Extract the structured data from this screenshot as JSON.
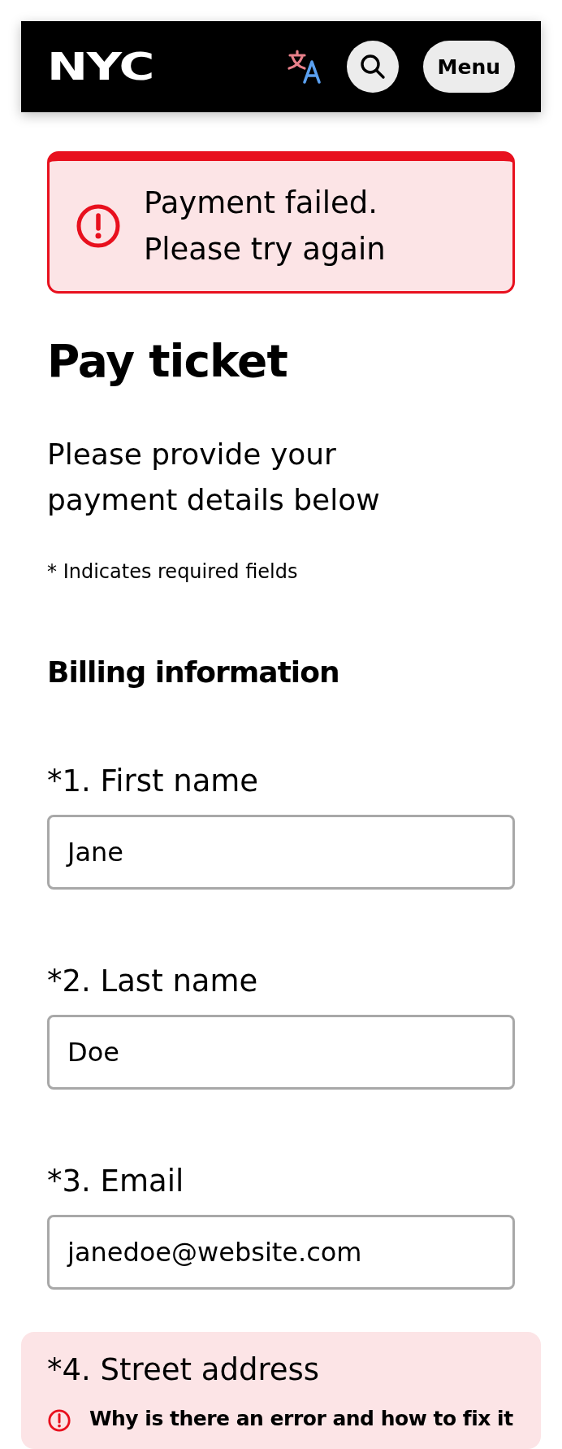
{
  "header": {
    "logo": "NYC",
    "menu_button": "Menu"
  },
  "alert": {
    "kind": "error",
    "message": "Payment failed. Please try again"
  },
  "title": "Pay ticket",
  "intro": "Please provide your payment details below",
  "required_note": "* Indicates required fields",
  "section_title": "Billing information",
  "fields": [
    {
      "label": "*1. First name",
      "value": "Jane",
      "error": false
    },
    {
      "label": "*2. Last name",
      "value": "Doe",
      "error": false
    },
    {
      "label": "*3. Email",
      "value": "janedoe@website.com",
      "error": false
    },
    {
      "label": "*4. Street address",
      "error": true,
      "error_message": "Why is there an error and how to fix it"
    }
  ]
}
